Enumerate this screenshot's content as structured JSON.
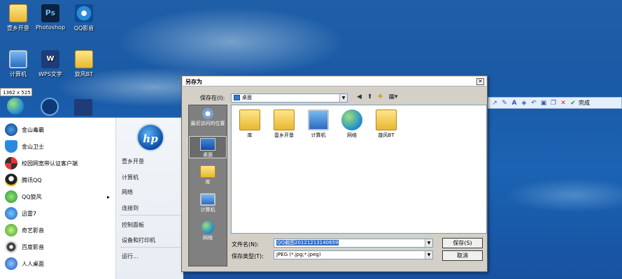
{
  "desktop": {
    "icons": [
      {
        "label": "壹乡开垦",
        "icon": "folder-user-icon"
      },
      {
        "label": "Photoshop",
        "icon": "photoshop-icon"
      },
      {
        "label": "QQ影音",
        "icon": "qq-player-icon"
      },
      {
        "label": "计算机",
        "icon": "computer-icon"
      },
      {
        "label": "WPS文字",
        "icon": "wps-icon"
      },
      {
        "label": "旋风BT",
        "icon": "folder-icon"
      }
    ],
    "resolution_badge": "1362 x 525"
  },
  "start_menu": {
    "pinned": [
      {
        "label": "金山毒霸"
      },
      {
        "label": "金山卫士"
      },
      {
        "label": "校园网宽带认证客户端"
      },
      {
        "label": "腾讯QQ"
      },
      {
        "label": "QQ旋风",
        "arrow": "▸"
      },
      {
        "label": "迅雷7"
      },
      {
        "label": "奇艺影音"
      },
      {
        "label": "百度影音"
      },
      {
        "label": "人人桌面"
      }
    ],
    "right": {
      "logo": "hp",
      "items": [
        "壹乡开垦",
        "计算机",
        "网络",
        "连接到",
        "控制面板",
        "设备和打印机",
        "运行..."
      ]
    }
  },
  "toolbar": {
    "confirm_label": "完成"
  },
  "dialog": {
    "title": "另存为",
    "save_in_label": "保存在(I):",
    "save_in_value": "桌面",
    "places": [
      {
        "label": "最近访问的位置",
        "icon": "recent-icon"
      },
      {
        "label": "桌面",
        "icon": "desktop-icon"
      },
      {
        "label": "库",
        "icon": "library-icon"
      },
      {
        "label": "计算机",
        "icon": "computer-icon"
      },
      {
        "label": "网络",
        "icon": "network-icon"
      }
    ],
    "files": [
      {
        "label": "库",
        "icon": "library-icon"
      },
      {
        "label": "壹乡开垦",
        "icon": "folder-user-icon"
      },
      {
        "label": "计算机",
        "icon": "computer-icon"
      },
      {
        "label": "网络",
        "icon": "network-icon"
      },
      {
        "label": "旋风BT",
        "icon": "folder-icon"
      }
    ],
    "filename_label": "文件名(N):",
    "filename_value": "QQ截图20121213140659",
    "filetype_label": "保存类型(T):",
    "filetype_value": "JPEG (*.jpg;*.jpeg)",
    "save_button": "保存(S)",
    "cancel_button": "取消"
  }
}
